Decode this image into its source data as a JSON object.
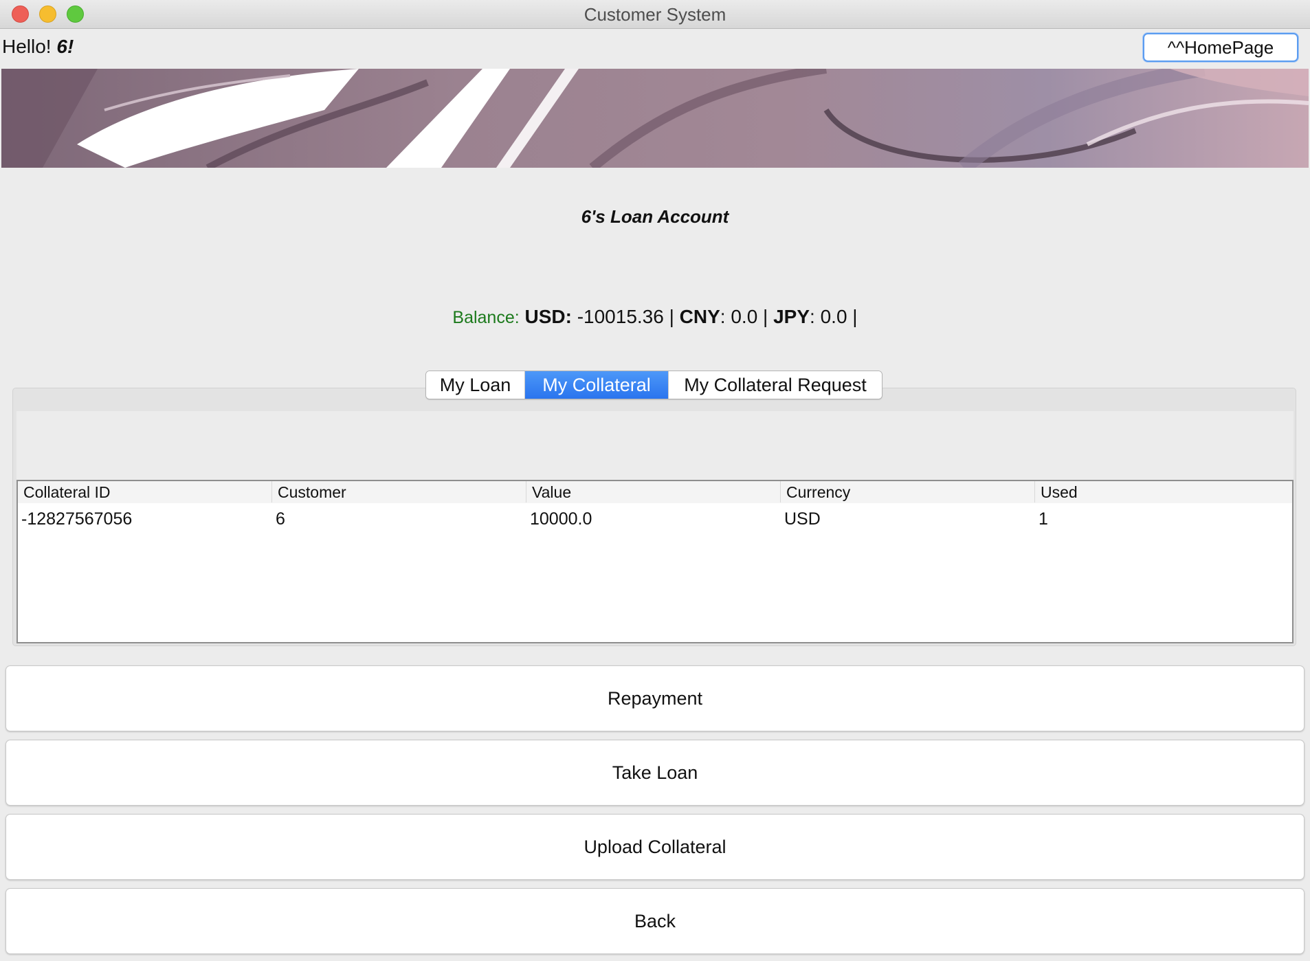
{
  "window": {
    "title": "Customer System"
  },
  "header": {
    "greeting_prefix": "Hello!",
    "greeting_name": "6!",
    "homepage_label": "^^HomePage"
  },
  "account": {
    "title": "6's Loan Account",
    "balance_label": "Balance:",
    "balance": [
      {
        "currency": "USD",
        "sep": ":",
        "amount": " -10015.36 |"
      },
      {
        "currency": "CNY",
        "sep": ":",
        "amount": " 0.0 |"
      },
      {
        "currency": "JPY",
        "sep": ":",
        "amount": " 0.0 |"
      }
    ]
  },
  "tabs": [
    {
      "label": "My Loan",
      "active": false
    },
    {
      "label": "My Collateral",
      "active": true
    },
    {
      "label": "My Collateral Request",
      "active": false
    }
  ],
  "table": {
    "columns": [
      "Collateral ID",
      "Customer",
      "Value",
      "Currency",
      "Used"
    ],
    "rows": [
      [
        "-12827567056",
        "6",
        "10000.0",
        "USD",
        "1"
      ]
    ]
  },
  "actions": {
    "repayment": "Repayment",
    "take_loan": "Take Loan",
    "upload_collateral": "Upload Collateral",
    "back": "Back"
  },
  "colors": {
    "accent_tab": "#2a74ee",
    "balance_label": "#1c7a1c"
  }
}
